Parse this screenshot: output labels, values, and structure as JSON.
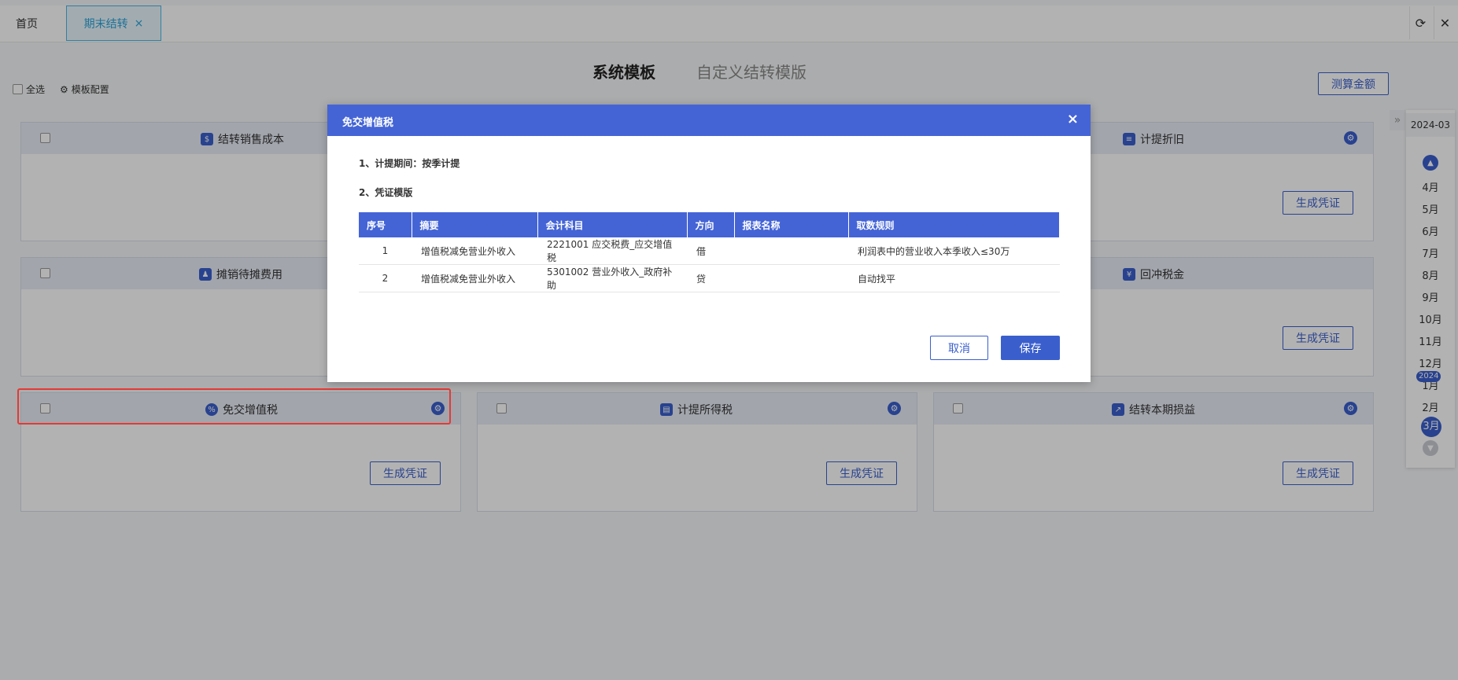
{
  "tabs": {
    "home": "首页",
    "active": "期末结转",
    "close_glyph": "×"
  },
  "window": {
    "refresh_glyph": "⟳",
    "close_glyph": "✕"
  },
  "header": {
    "tab_system": "系统模板",
    "tab_custom": "自定义结转模版"
  },
  "toolbar": {
    "select_all": "全选",
    "template_config": "模板配置",
    "calc_amount": "测算金额"
  },
  "cards": [
    {
      "title": "结转销售成本",
      "icon": "bank-icon",
      "generate": ""
    },
    {
      "title": "计提折旧",
      "icon": "depreciation-icon",
      "generate": "生成凭证"
    },
    {
      "title": "摊销待摊费用",
      "icon": "user-icon",
      "generate": ""
    },
    {
      "title": "回冲税金",
      "icon": "tax-icon",
      "generate": "生成凭证"
    },
    {
      "title": "免交增值税",
      "icon": "percent-icon",
      "generate": "生成凭证"
    },
    {
      "title": "计提所得税",
      "icon": "clipboard-icon",
      "generate": "生成凭证"
    },
    {
      "title": "结转本期损益",
      "icon": "chart-icon",
      "generate": "生成凭证"
    }
  ],
  "sidebar": {
    "current": "2024-03",
    "year_badge": "2024",
    "months": [
      "4月",
      "5月",
      "6月",
      "7月",
      "8月",
      "9月",
      "10月",
      "11月",
      "12月",
      "1月",
      "2月",
      "3月"
    ],
    "selected": "3月"
  },
  "dialog": {
    "title": "免交增值税",
    "close_glyph": "×",
    "line1": "1、计提期间：按季计提",
    "line2": "2、凭证模版",
    "columns": [
      "序号",
      "摘要",
      "会计科目",
      "方向",
      "报表名称",
      "取数规则"
    ],
    "rows": [
      [
        "1",
        "增值税减免营业外收入",
        "2221001 应交税费_应交增值税",
        "借",
        "",
        "利润表中的营业收入本季收入≤30万"
      ],
      [
        "2",
        "增值税减免营业外收入",
        "5301002 营业外收入_政府补助",
        "贷",
        "",
        "自动找平"
      ]
    ],
    "cancel": "取消",
    "save": "保存"
  },
  "colors": {
    "accent": "#3a5fcd",
    "dialog_header": "#4464d6",
    "highlight": "#e53935"
  }
}
